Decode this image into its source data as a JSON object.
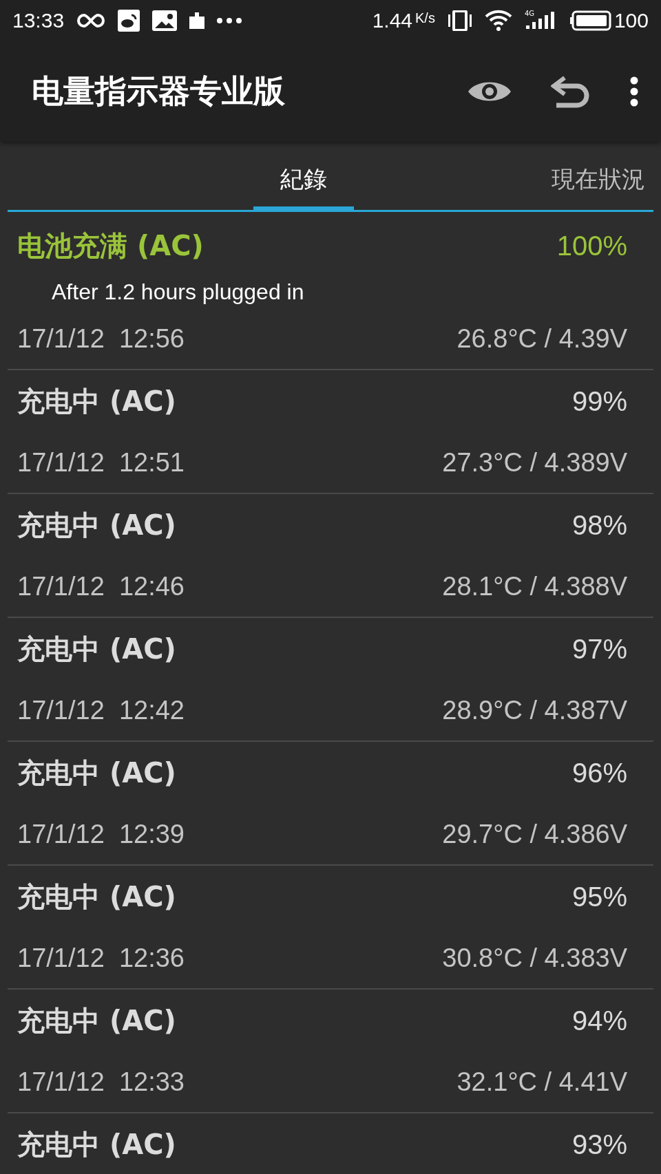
{
  "status_bar": {
    "time": "13:33",
    "speed": "1.44",
    "speed_unit": "K/s",
    "network_type": "4G",
    "battery": "100"
  },
  "app_bar": {
    "title": "电量指示器专业版"
  },
  "tabs": [
    {
      "label": "紀錄",
      "selected": true
    },
    {
      "label": "現在狀況",
      "selected": false
    }
  ],
  "entries": [
    {
      "kind": "full",
      "status": "电池充满 (AC)",
      "percent": "100%",
      "note": "After 1.2 hours plugged in",
      "date": "17/1/12  12:56",
      "reading": "26.8°C / 4.39V"
    },
    {
      "kind": "charging",
      "status": "充电中 (AC)",
      "percent": "99%",
      "date": "17/1/12  12:51",
      "reading": "27.3°C / 4.389V"
    },
    {
      "kind": "charging",
      "status": "充电中 (AC)",
      "percent": "98%",
      "date": "17/1/12  12:46",
      "reading": "28.1°C / 4.388V"
    },
    {
      "kind": "charging",
      "status": "充电中 (AC)",
      "percent": "97%",
      "date": "17/1/12  12:42",
      "reading": "28.9°C / 4.387V"
    },
    {
      "kind": "charging",
      "status": "充电中 (AC)",
      "percent": "96%",
      "date": "17/1/12  12:39",
      "reading": "29.7°C / 4.386V"
    },
    {
      "kind": "charging",
      "status": "充电中 (AC)",
      "percent": "95%",
      "date": "17/1/12  12:36",
      "reading": "30.8°C / 4.383V"
    },
    {
      "kind": "charging",
      "status": "充电中 (AC)",
      "percent": "94%",
      "date": "17/1/12  12:33",
      "reading": "32.1°C / 4.41V"
    },
    {
      "kind": "charging",
      "status": "充电中 (AC)",
      "percent": "93%"
    }
  ]
}
